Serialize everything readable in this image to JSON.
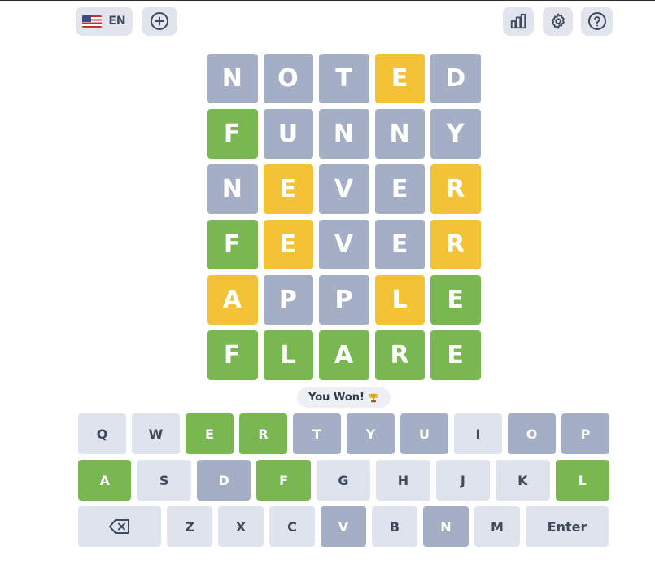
{
  "colors": {
    "correct": "#79b851",
    "present": "#f3c237",
    "absent": "#a4aec4",
    "unused": "#dfe3ed"
  },
  "header": {
    "language_label": "EN",
    "language_flag": "us-flag-icon",
    "new_game_icon": "plus-circle-icon",
    "stats_icon": "bar-chart-icon",
    "settings_icon": "gear-icon",
    "help_icon": "question-circle-icon"
  },
  "board": [
    [
      {
        "l": "N",
        "s": "absent"
      },
      {
        "l": "O",
        "s": "absent"
      },
      {
        "l": "T",
        "s": "absent"
      },
      {
        "l": "E",
        "s": "present"
      },
      {
        "l": "D",
        "s": "absent"
      }
    ],
    [
      {
        "l": "F",
        "s": "correct"
      },
      {
        "l": "U",
        "s": "absent"
      },
      {
        "l": "N",
        "s": "absent"
      },
      {
        "l": "N",
        "s": "absent"
      },
      {
        "l": "Y",
        "s": "absent"
      }
    ],
    [
      {
        "l": "N",
        "s": "absent"
      },
      {
        "l": "E",
        "s": "present"
      },
      {
        "l": "V",
        "s": "absent"
      },
      {
        "l": "E",
        "s": "absent"
      },
      {
        "l": "R",
        "s": "present"
      }
    ],
    [
      {
        "l": "F",
        "s": "correct"
      },
      {
        "l": "E",
        "s": "present"
      },
      {
        "l": "V",
        "s": "absent"
      },
      {
        "l": "E",
        "s": "absent"
      },
      {
        "l": "R",
        "s": "present"
      }
    ],
    [
      {
        "l": "A",
        "s": "present"
      },
      {
        "l": "P",
        "s": "absent"
      },
      {
        "l": "P",
        "s": "absent"
      },
      {
        "l": "L",
        "s": "present"
      },
      {
        "l": "E",
        "s": "correct"
      }
    ],
    [
      {
        "l": "F",
        "s": "correct"
      },
      {
        "l": "L",
        "s": "correct"
      },
      {
        "l": "A",
        "s": "correct"
      },
      {
        "l": "R",
        "s": "correct"
      },
      {
        "l": "E",
        "s": "correct"
      }
    ]
  ],
  "toast": {
    "text": "You Won!",
    "icon": "trophy-icon"
  },
  "keyboard": {
    "rows": [
      [
        {
          "k": "Q",
          "s": "unused"
        },
        {
          "k": "W",
          "s": "unused"
        },
        {
          "k": "E",
          "s": "correct"
        },
        {
          "k": "R",
          "s": "correct"
        },
        {
          "k": "T",
          "s": "absent"
        },
        {
          "k": "Y",
          "s": "absent"
        },
        {
          "k": "U",
          "s": "absent"
        },
        {
          "k": "I",
          "s": "unused"
        },
        {
          "k": "O",
          "s": "absent"
        },
        {
          "k": "P",
          "s": "absent"
        }
      ],
      [
        {
          "k": "A",
          "s": "correct"
        },
        {
          "k": "S",
          "s": "unused"
        },
        {
          "k": "D",
          "s": "absent"
        },
        {
          "k": "F",
          "s": "correct"
        },
        {
          "k": "G",
          "s": "unused"
        },
        {
          "k": "H",
          "s": "unused"
        },
        {
          "k": "J",
          "s": "unused"
        },
        {
          "k": "K",
          "s": "unused"
        },
        {
          "k": "L",
          "s": "correct"
        }
      ],
      [
        {
          "k": "backspace",
          "s": "unused",
          "icon": "backspace-icon"
        },
        {
          "k": "Z",
          "s": "unused"
        },
        {
          "k": "X",
          "s": "unused"
        },
        {
          "k": "C",
          "s": "unused"
        },
        {
          "k": "V",
          "s": "absent"
        },
        {
          "k": "B",
          "s": "unused"
        },
        {
          "k": "N",
          "s": "absent"
        },
        {
          "k": "M",
          "s": "unused"
        },
        {
          "k": "Enter",
          "s": "unused"
        }
      ]
    ]
  }
}
